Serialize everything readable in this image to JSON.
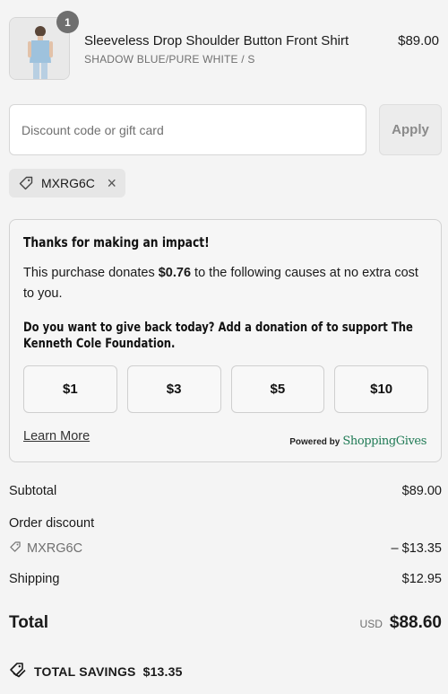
{
  "line_item": {
    "quantity": "1",
    "name": "Sleeveless Drop Shoulder Button Front Shirt",
    "variant": "SHADOW BLUE/PURE WHITE / S",
    "price": "$89.00",
    "image_icon": "shirt-product-photo"
  },
  "discount": {
    "placeholder": "Discount code or gift card",
    "value": "",
    "apply_label": "Apply",
    "applied_code": "MXRG6C",
    "remove_icon": "×"
  },
  "impact": {
    "title": "Thanks for making an impact!",
    "text_before": "This purchase donates ",
    "donation_amount": "$0.76",
    "text_after": " to the following causes at no extra cost to you.",
    "question": "Do you want to give back today? Add a donation of to support The Kenneth Cole Foundation.",
    "options": [
      "$1",
      "$3",
      "$5",
      "$10"
    ],
    "learn_more": "Learn More",
    "powered_by": "Powered by",
    "brand": "ShoppingGives"
  },
  "summary": {
    "subtotal_label": "Subtotal",
    "subtotal_value": "$89.00",
    "order_discount_label": "Order discount",
    "discount_code": "MXRG6C",
    "discount_value": "– $13.35",
    "shipping_label": "Shipping",
    "shipping_value": "$12.95",
    "total_label": "Total",
    "currency": "USD",
    "total_value": "$88.60",
    "savings_label": "TOTAL SAVINGS",
    "savings_value": "$13.35"
  },
  "colors": {
    "background": "#f4f4f4",
    "brand_green": "#1f7a55",
    "muted_text": "#707070"
  }
}
